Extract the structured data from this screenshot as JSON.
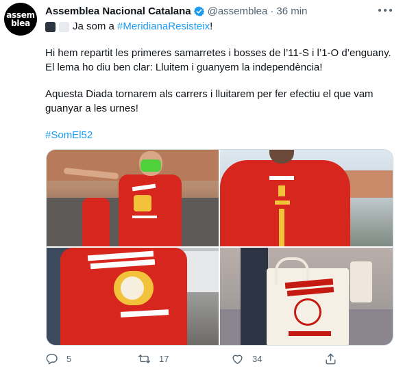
{
  "tweet": {
    "avatar_line1": "assem",
    "avatar_line2": "blea",
    "author_name": "Assemblea Nacional Catalana",
    "handle": "@assemblea",
    "separator": "·",
    "time": "36 min",
    "line1_text": "Ja som a ",
    "line1_hashtag": "#MeridianaResisteix",
    "line1_end": "!",
    "line2": "Hi hem repartit les primeres samarretes i bosses de l’11-S i l’1-O d’enguany.",
    "line3": "El lema ho diu ben clar: Lluitem i guanyem la independència!",
    "line4": "Aquesta Diada tornarem als carrers i lluitarem per fer efectiu el que vam",
    "line5": "guanyar a les urnes!",
    "hashtag2": "#SomEl52"
  },
  "photos": {
    "shirt_text_1": "LLUITEM GUANYEM",
    "shirt_text_2": "LA INDEPENDÈNCIA",
    "back_top": "11S",
    "back_mid": "1 OCT",
    "back_vertical": "IN DE PEN DEN CI"
  },
  "actions": {
    "reply_count": "5",
    "retweet_count": "17",
    "like_count": "34"
  },
  "icons": {
    "verified": "verified-badge-icon",
    "more": "more-options-icon",
    "reply": "reply-icon",
    "retweet": "retweet-icon",
    "like": "heart-icon",
    "share": "share-icon"
  },
  "colors": {
    "link": "#1d9bf0",
    "muted": "#536471",
    "verified": "#1d9bf0",
    "shirt_red": "#d7261e"
  }
}
